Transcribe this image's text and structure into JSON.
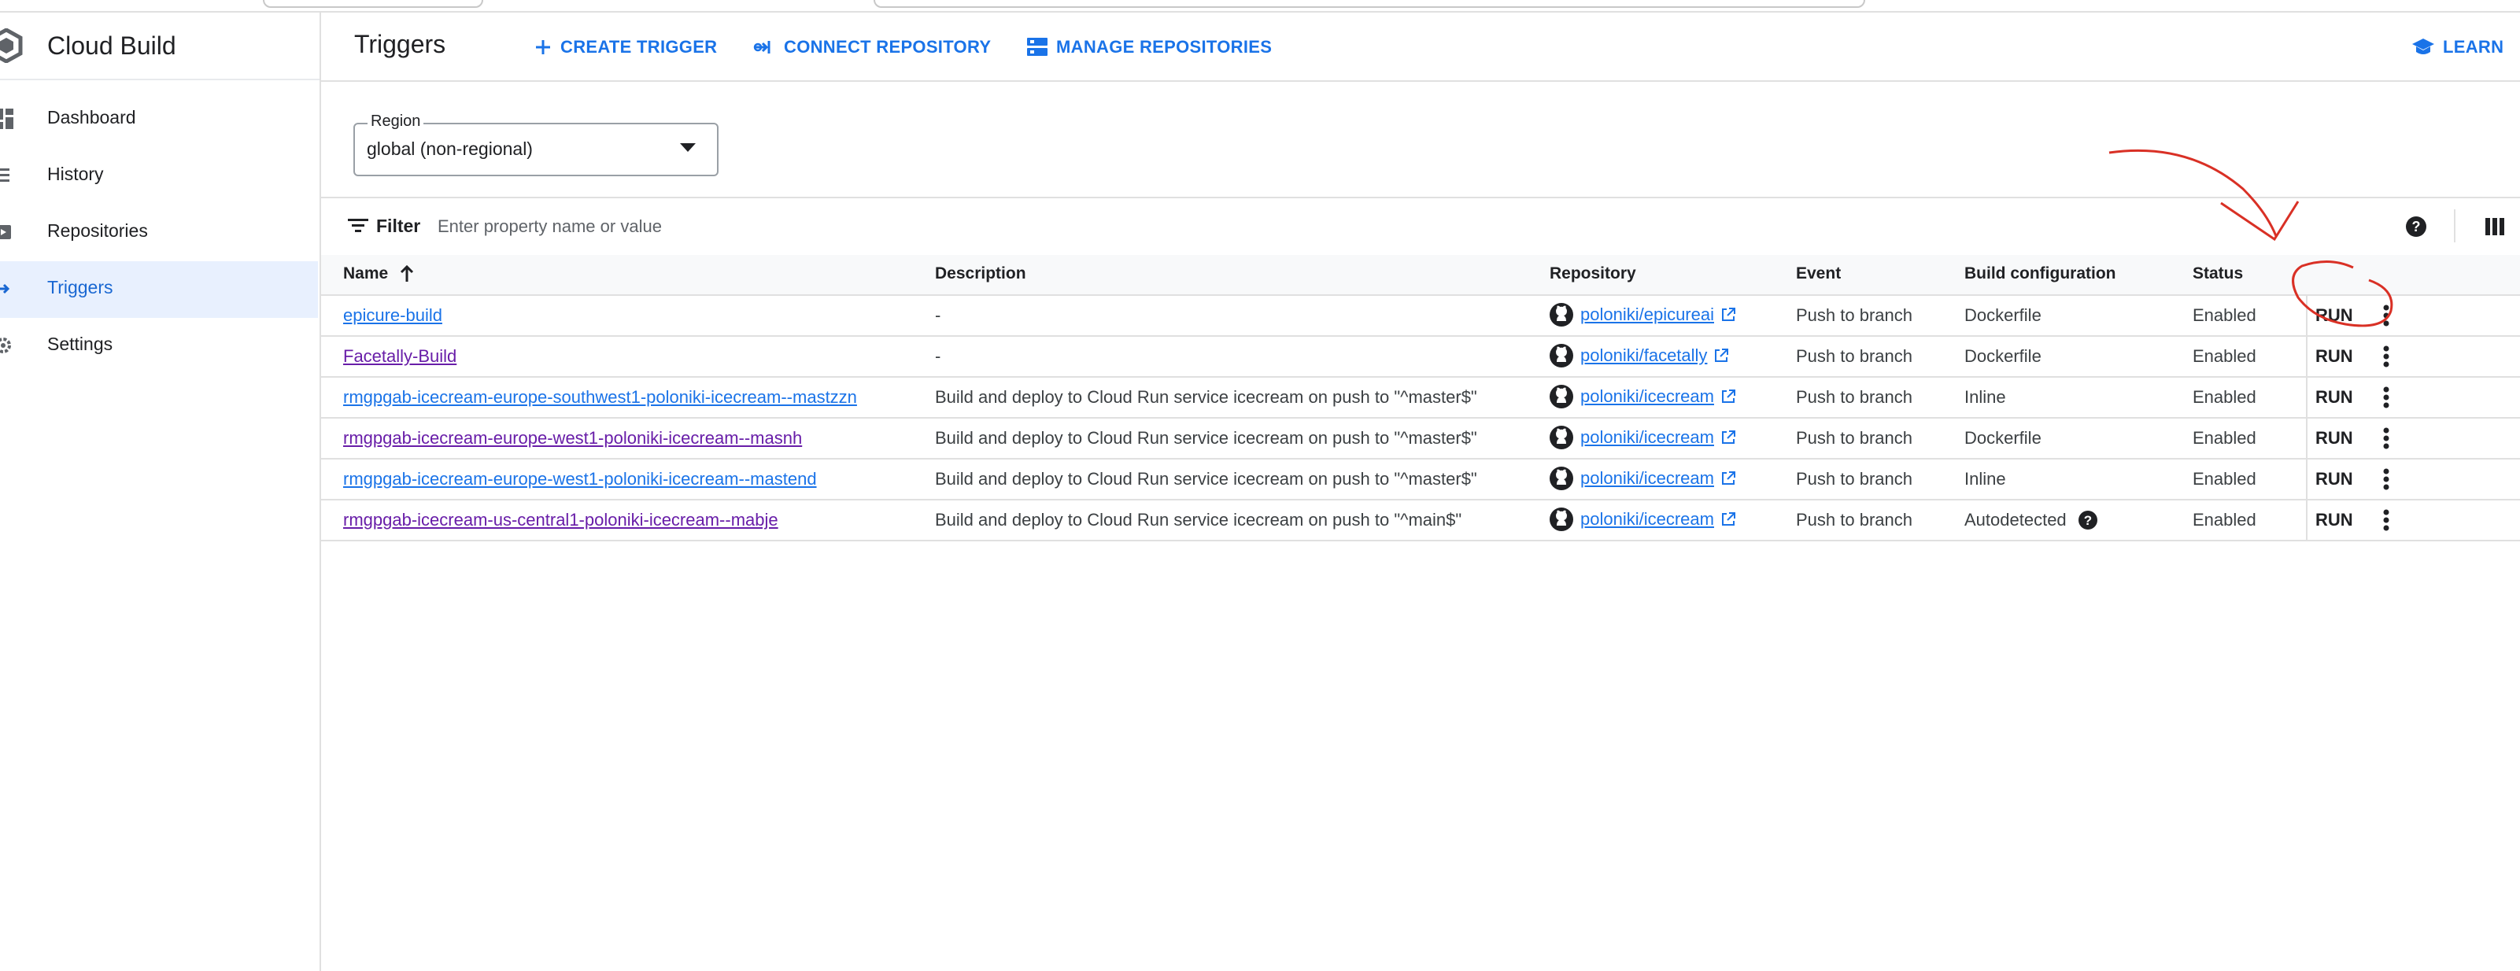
{
  "app": {
    "title": "Cloud Build"
  },
  "sidebar": {
    "items": [
      {
        "label": "Dashboard",
        "icon": "dashboard-icon"
      },
      {
        "label": "History",
        "icon": "list-icon"
      },
      {
        "label": "Repositories",
        "icon": "repository-icon"
      },
      {
        "label": "Triggers",
        "icon": "arrow-right-icon",
        "active": true
      },
      {
        "label": "Settings",
        "icon": "gear-icon"
      }
    ]
  },
  "header": {
    "title": "Triggers",
    "create_trigger": "CREATE TRIGGER",
    "connect_repository": "CONNECT REPOSITORY",
    "manage_repositories": "MANAGE REPOSITORIES",
    "learn": "LEARN"
  },
  "region": {
    "label": "Region",
    "value": "global (non-regional)"
  },
  "filter": {
    "label": "Filter",
    "placeholder": "Enter property name or value"
  },
  "table": {
    "columns": {
      "name": "Name",
      "description": "Description",
      "repository": "Repository",
      "event": "Event",
      "build_config": "Build configuration",
      "status": "Status"
    },
    "run_label": "RUN",
    "rows": [
      {
        "name": "epicure-build",
        "visited": false,
        "description": "-",
        "repository": "poloniki/epicureai",
        "event": "Push to branch",
        "build_config": "Dockerfile",
        "status": "Enabled",
        "config_help": false
      },
      {
        "name": "Facetally-Build",
        "visited": true,
        "description": "-",
        "repository": "poloniki/facetally",
        "event": "Push to branch",
        "build_config": "Dockerfile",
        "status": "Enabled",
        "config_help": false
      },
      {
        "name": "rmgpgab-icecream-europe-southwest1-poloniki-icecream--mastzzn",
        "visited": false,
        "description": "Build and deploy to Cloud Run service icecream on push to \"^master$\"",
        "repository": "poloniki/icecream",
        "event": "Push to branch",
        "build_config": "Inline",
        "status": "Enabled",
        "config_help": false
      },
      {
        "name": "rmgpgab-icecream-europe-west1-poloniki-icecream--masnh",
        "visited": true,
        "description": "Build and deploy to Cloud Run service icecream on push to \"^master$\"",
        "repository": "poloniki/icecream",
        "event": "Push to branch",
        "build_config": "Dockerfile",
        "status": "Enabled",
        "config_help": false
      },
      {
        "name": "rmgpgab-icecream-europe-west1-poloniki-icecream--mastend",
        "visited": false,
        "description": "Build and deploy to Cloud Run service icecream on push to \"^master$\"",
        "repository": "poloniki/icecream",
        "event": "Push to branch",
        "build_config": "Inline",
        "status": "Enabled",
        "config_help": false
      },
      {
        "name": "rmgpgab-icecream-us-central1-poloniki-icecream--mabje",
        "visited": true,
        "description": "Build and deploy to Cloud Run service icecream on push to \"^main$\"",
        "repository": "poloniki/icecream",
        "event": "Push to branch",
        "build_config": "Autodetected",
        "status": "Enabled",
        "config_help": true
      }
    ]
  },
  "colors": {
    "accent": "#1a73e8",
    "visited": "#681da8",
    "annotation": "#d93025",
    "active_bg": "#e8f0fe"
  }
}
